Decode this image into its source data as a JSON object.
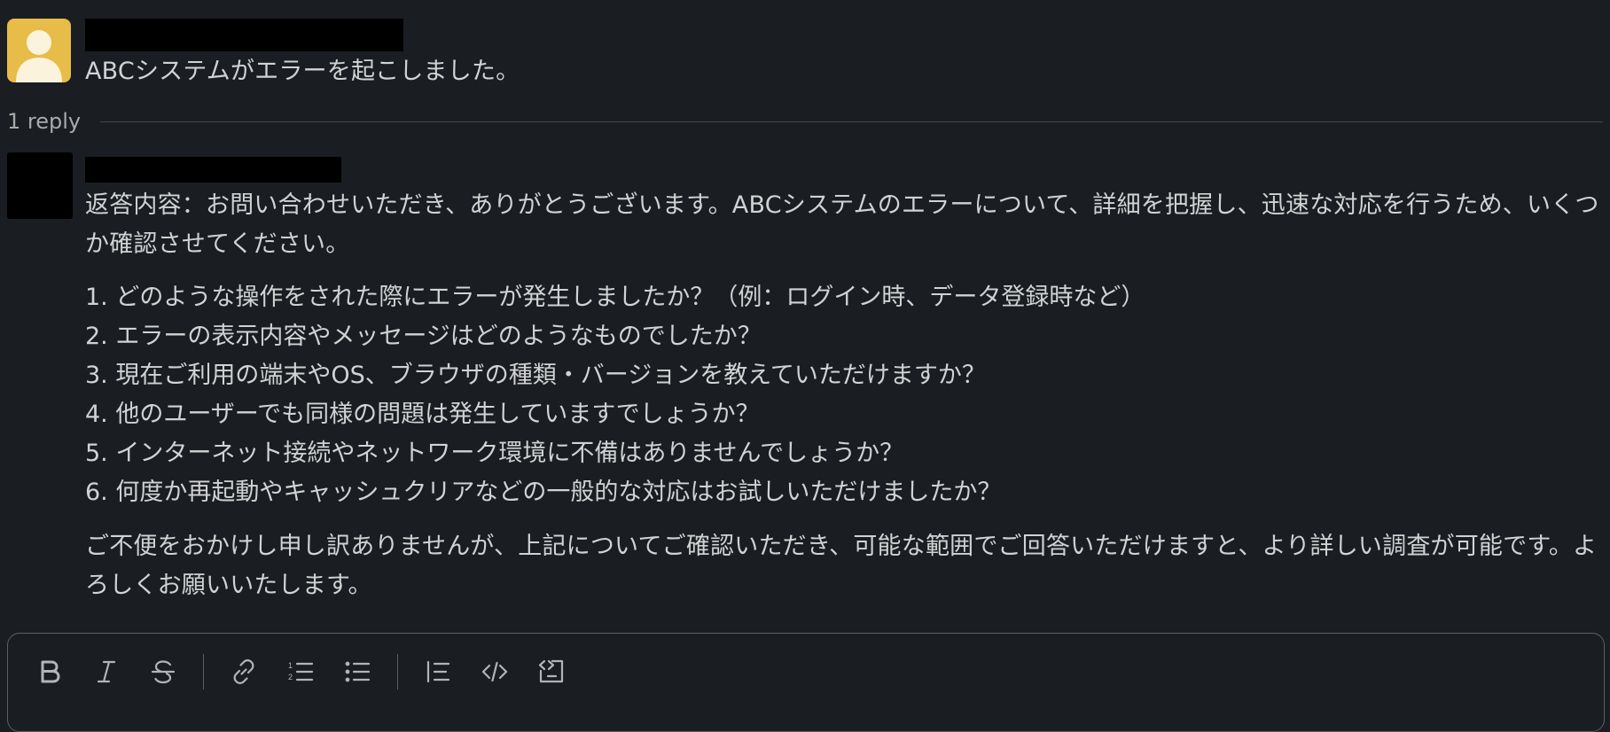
{
  "thread": {
    "parent": {
      "text": "ABCシステムがエラーを起こしました。"
    },
    "reply_count": "1 reply",
    "reply": {
      "intro": "返答内容：お問い合わせいただき、ありがとうございます。ABCシステムのエラーについて、詳細を把握し、迅速な対応を行うため、いくつか確認させてください。",
      "questions": [
        "1. どのような操作をされた際にエラーが発生しましたか？（例：ログイン時、データ登録時など）",
        "2. エラーの表示内容やメッセージはどのようなものでしたか？",
        "3. 現在ご利用の端末やOS、ブラウザの種類・バージョンを教えていただけますか？",
        "4. 他のユーザーでも同様の問題は発生していますでしょうか？",
        "5. インターネット接続やネットワーク環境に不備はありませんでしょうか？",
        "6. 何度か再起動やキャッシュクリアなどの一般的な対応はお試しいただけましたか？"
      ],
      "closing": "ご不便をおかけし申し訳ありませんが、上記についてご確認いただき、可能な範囲でご回答いただけますと、より詳しい調査が可能です。よろしくお願いいたします。"
    }
  },
  "composer": {
    "toolbar": [
      "bold-icon",
      "italic-icon",
      "strikethrough-icon",
      "link-icon",
      "ordered-list-icon",
      "bulleted-list-icon",
      "blockquote-icon",
      "code-icon",
      "code-block-icon"
    ]
  },
  "colors": {
    "background": "#1a1d21",
    "text": "#d1d2d3",
    "avatar_yellow": "#e8bc48",
    "divider": "#44464a"
  }
}
